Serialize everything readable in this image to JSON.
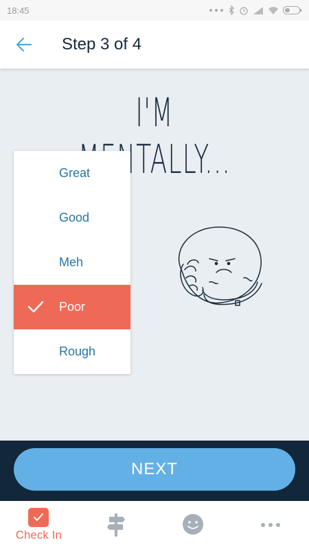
{
  "status_bar": {
    "time": "18:45"
  },
  "header": {
    "title": "Step 3 of 4"
  },
  "headline": "I'M MENTALLY...",
  "options": [
    {
      "label": "Great",
      "selected": false
    },
    {
      "label": "Good",
      "selected": false
    },
    {
      "label": "Meh",
      "selected": false
    },
    {
      "label": "Poor",
      "selected": true
    },
    {
      "label": "Rough",
      "selected": false
    }
  ],
  "next_button": {
    "label": "NEXT"
  },
  "tabs": [
    {
      "label": "Check In",
      "icon": "check-in-icon",
      "active": true
    },
    {
      "label": "",
      "icon": "signpost-icon",
      "active": false
    },
    {
      "label": "",
      "icon": "smiley-icon",
      "active": false
    },
    {
      "label": "",
      "icon": "more-icon",
      "active": false
    }
  ],
  "colors": {
    "accent": "#ef6a56",
    "primary_button": "#63b0e6",
    "dark_band": "#13273a",
    "link_text": "#2676a4",
    "background": "#e9eef2"
  }
}
